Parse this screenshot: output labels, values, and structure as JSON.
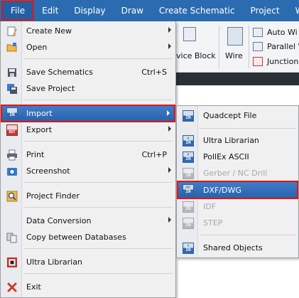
{
  "menubar": {
    "items": [
      "File",
      "Edit",
      "Display",
      "Draw",
      "Create Schematic",
      "Project",
      "W"
    ]
  },
  "ribbon": {
    "device_block": "vice Block",
    "wire": "Wire",
    "auto_wire": "Auto Wi",
    "parallel_wire": "Parallel W",
    "junction": "Junction"
  },
  "file_menu": {
    "items": [
      {
        "label": "Create New",
        "icon": "create-new-icon",
        "has_submenu": true
      },
      {
        "label": "Open",
        "icon": "open-folder-icon",
        "has_submenu": true
      },
      {
        "label": "Save Schematics",
        "icon": "save-icon",
        "shortcut": "Ctrl+S"
      },
      {
        "label": "Save Project",
        "icon": "save-project-icon"
      },
      {
        "label": "Import",
        "icon": "import-icon",
        "has_submenu": true,
        "highlighted": true
      },
      {
        "label": "Export",
        "icon": "export-icon",
        "has_submenu": true
      },
      {
        "label": "Print",
        "icon": "printer-icon",
        "shortcut": "Ctrl+P"
      },
      {
        "label": "Screenshot",
        "icon": "camera-icon",
        "has_submenu": true
      },
      {
        "label": "Project Finder",
        "icon": "finder-icon"
      },
      {
        "label": "Data Conversion",
        "icon": "",
        "has_submenu": true
      },
      {
        "label": "Copy between Databases",
        "icon": "copy-db-icon"
      },
      {
        "label": "Ultra Librarian",
        "icon": "chip-icon"
      },
      {
        "label": "Exit",
        "icon": "exit-icon"
      }
    ]
  },
  "import_submenu": {
    "items": [
      {
        "label": "Quadcept File",
        "badge_top": "",
        "enabled": true
      },
      {
        "label": "Ultra Librarian",
        "badge_top": "U",
        "enabled": true
      },
      {
        "label": "PollEx ASCII",
        "badge_top": "P",
        "enabled": true
      },
      {
        "label": "Gerber / NC Drill",
        "badge_top": "GBR",
        "enabled": false
      },
      {
        "label": "DXF/DWG",
        "badge_top": "DXF",
        "enabled": true,
        "highlighted": true
      },
      {
        "label": "IDF",
        "badge_top": "IDF",
        "enabled": false
      },
      {
        "label": "STEP",
        "badge_top": "STEP",
        "enabled": false
      },
      {
        "label": "Shared Objects",
        "badge_top": "S",
        "enabled": true
      }
    ],
    "badge_bottom": "IN"
  },
  "export_badge": "OUT",
  "colors": {
    "menubar": "#2b6cb0",
    "highlight": "#2b63ab",
    "callout": "#e01515"
  }
}
